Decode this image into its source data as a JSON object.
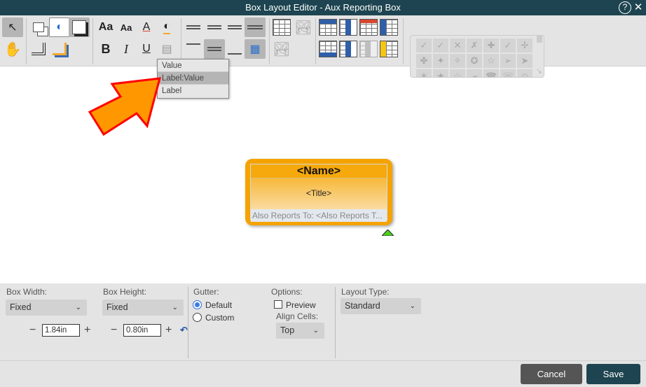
{
  "window": {
    "title": "Box Layout Editor - Aux Reporting Box",
    "help_icon": "help-circle-icon",
    "close_icon": "close-icon"
  },
  "toolbar": {
    "font_size_label": "Aa",
    "font_small_label": "Aa",
    "bold_label": "B",
    "italic_label": "I",
    "underline_label": "U",
    "font_color_label": "A",
    "dropdown": {
      "items": [
        "Value",
        "Label:Value",
        "Label"
      ],
      "highlighted": "Label:Value"
    },
    "symbols": [
      "✓",
      "✓",
      "✕",
      "✗",
      "✚",
      "✓",
      "✢",
      "✤",
      "✦",
      "✧",
      "✪",
      "☆",
      "➢",
      "➤",
      "☀",
      "★",
      "☆",
      "☁",
      "☎",
      "☏",
      "☺"
    ]
  },
  "box": {
    "name": "<Name>",
    "title": "<Title>",
    "also_reports": "Also Reports To: <Also Reports T...",
    "border_color": "#f5a300"
  },
  "panel": {
    "box_width": {
      "label": "Box Width:",
      "mode": "Fixed",
      "value": "1.84in"
    },
    "box_height": {
      "label": "Box Height:",
      "mode": "Fixed",
      "value": "0.80in"
    },
    "gutter": {
      "label": "Gutter:",
      "options": [
        "Default",
        "Custom"
      ],
      "selected": "Default"
    },
    "options": {
      "label": "Options:",
      "preview_label": "Preview",
      "preview_checked": false,
      "align_cells_label": "Align Cells:",
      "align_cells_value": "Top"
    },
    "layout_type": {
      "label": "Layout Type:",
      "value": "Standard"
    },
    "minus": "−",
    "plus": "+"
  },
  "footer": {
    "cancel": "Cancel",
    "save": "Save"
  },
  "colors": {
    "titlebar": "#1d4450",
    "save": "#1d4450",
    "cancel": "#555555",
    "accent": "#f5a300",
    "arrow": "#ff9800",
    "arrow_outline": "#ff0000"
  }
}
